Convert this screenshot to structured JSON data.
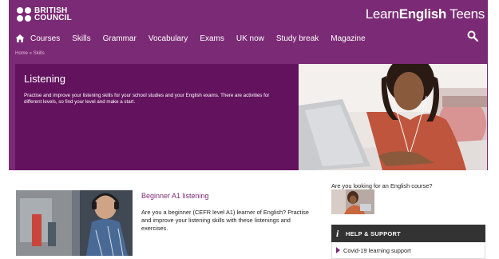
{
  "header": {
    "logo_line1": "BRITISH",
    "logo_line2": "COUNCIL",
    "brand_prefix": "Learn",
    "brand_bold": "English",
    "brand_suffix": " Teens"
  },
  "nav": {
    "items": [
      "Courses",
      "Skills",
      "Grammar",
      "Vocabulary",
      "Exams",
      "UK now",
      "Study break",
      "Magazine"
    ]
  },
  "breadcrumb": {
    "home": "Home",
    "separator": " » ",
    "current": "Skills"
  },
  "banner": {
    "title": "Listening",
    "description": "Practise and improve your listening skills for your school studies and your English exams. There are activities for different levels, so find your level and make a start."
  },
  "card": {
    "title": "Beginner A1 listening",
    "description": "Are you a beginner (CEFR level A1) learner of English? Practise and improve your listening skills with these listenings and exercises."
  },
  "sidebar": {
    "promo_question": "Are you looking for an English course?",
    "help_icon": "i",
    "help_title": "HELP & SUPPORT",
    "help_items": [
      "Covid-19 learning support"
    ]
  },
  "colors": {
    "brand_purple": "#7b2a75",
    "banner_purple": "#63125e",
    "help_bar": "#333333"
  }
}
